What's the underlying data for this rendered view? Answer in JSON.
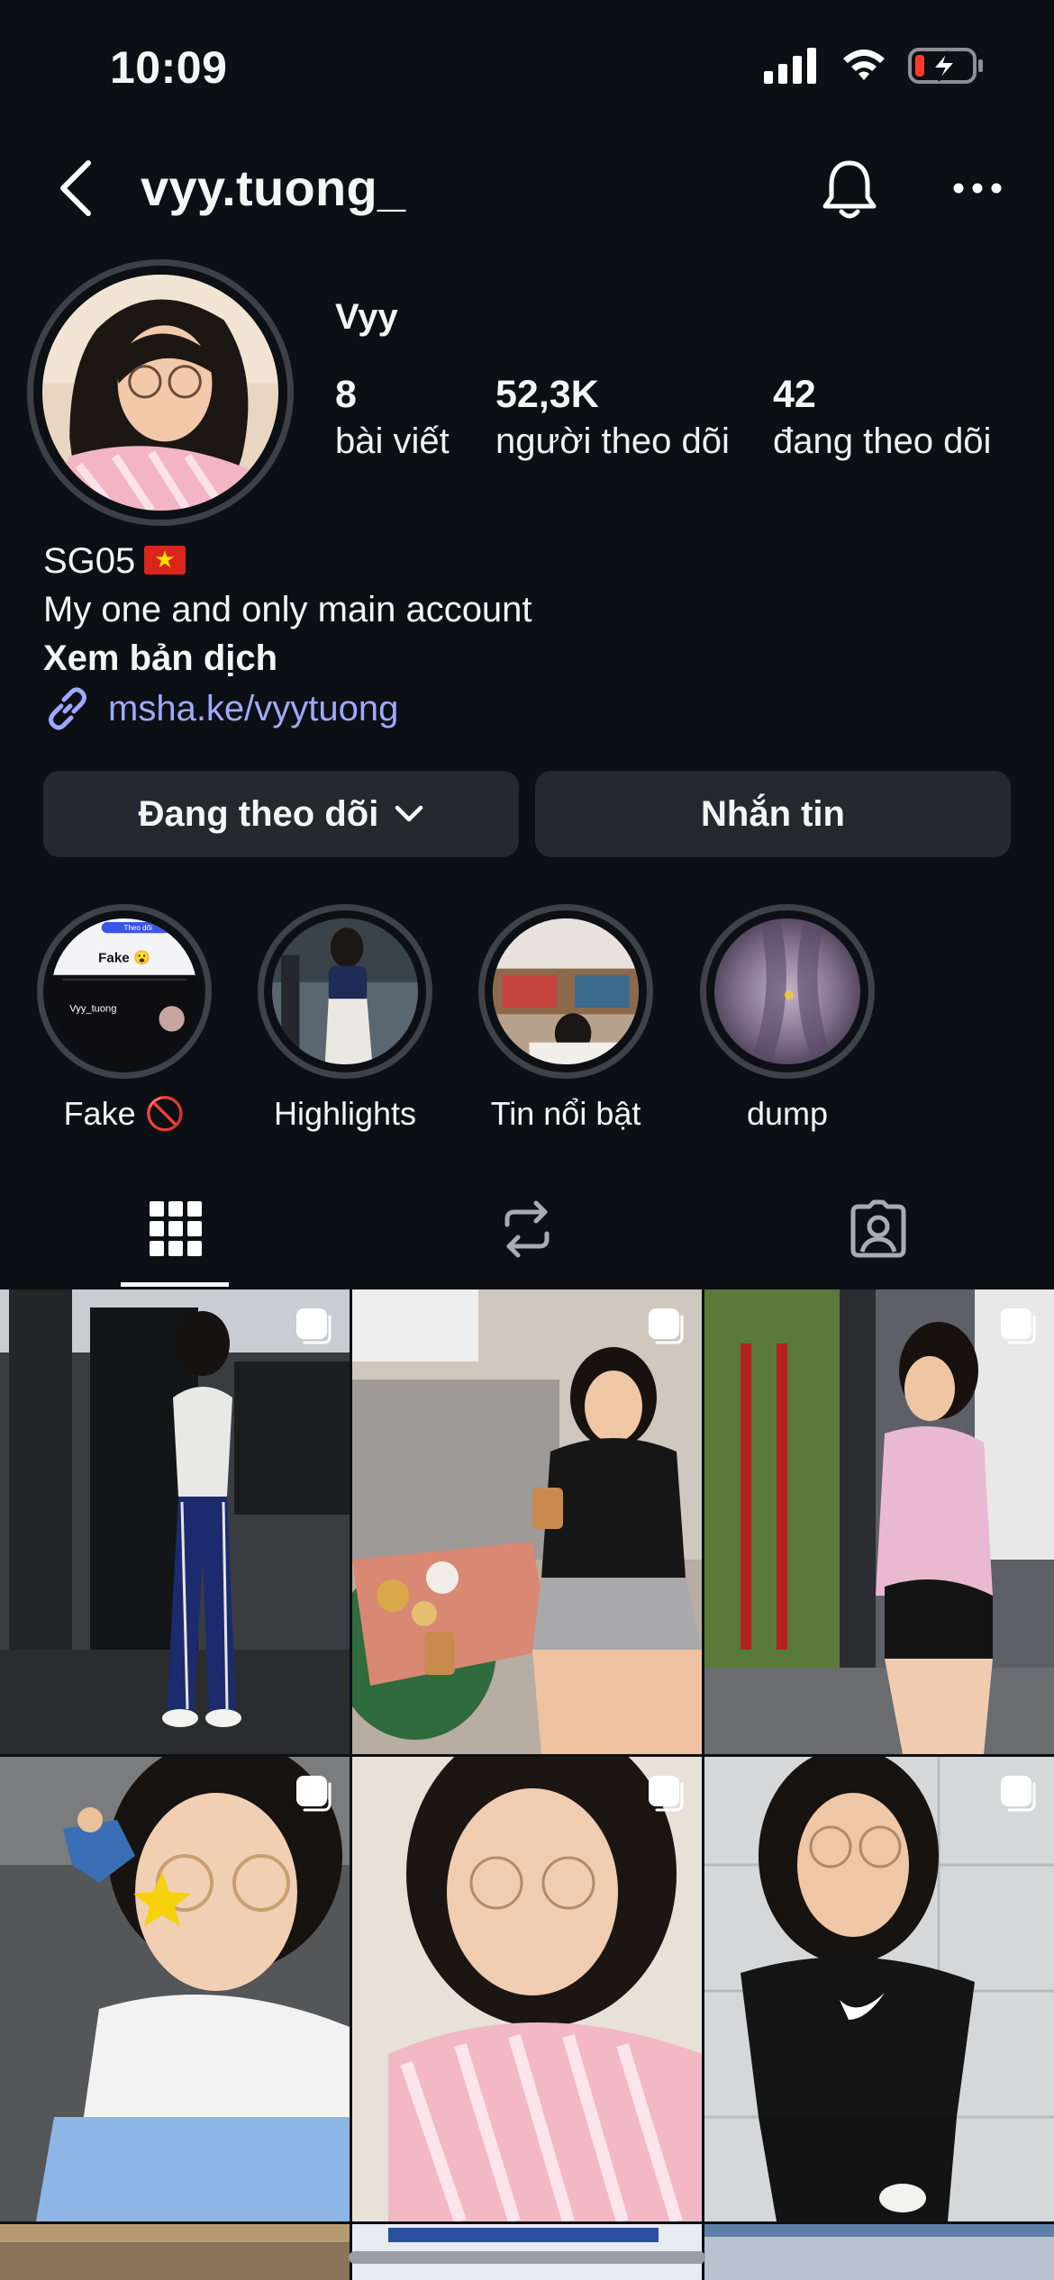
{
  "status_bar": {
    "time": "10:09"
  },
  "header": {
    "username": "vyy.tuong_"
  },
  "profile": {
    "display_name": "Vyy",
    "stats": [
      {
        "value": "8",
        "label": "bài viết"
      },
      {
        "value": "52,3K",
        "label": "người theo dõi"
      },
      {
        "value": "42",
        "label": "đang theo dõi"
      }
    ],
    "bio": {
      "line1": "SG05",
      "line2": "My one and only main account",
      "translate": "Xem bản dịch",
      "link": "msha.ke/vyytuong"
    }
  },
  "actions": {
    "following_label": "Đang theo dõi",
    "message_label": "Nhắn tin"
  },
  "highlights": [
    {
      "label": "Fake 🚫"
    },
    {
      "label": "Highlights"
    },
    {
      "label": "Tin nổi bật"
    },
    {
      "label": "dump"
    }
  ],
  "highlight_preview": {
    "title": "Fake 😮",
    "tab": "Theo dõi",
    "user": "Vyy_tuong"
  },
  "icons": {
    "back": "back-arrow-icon",
    "bell": "bell-icon",
    "more": "more-dots-icon",
    "grid": "grid-icon",
    "reels": "reels-icon",
    "tagged": "tagged-icon"
  },
  "colors": {
    "background": "#0c1014",
    "link": "#a0a8ff",
    "button": "#25292e",
    "battery_low": "#ff3b30"
  }
}
